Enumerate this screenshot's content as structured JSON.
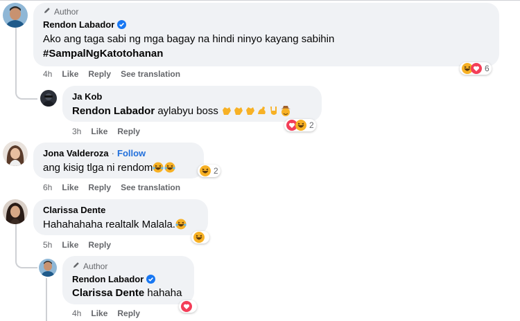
{
  "comments": [
    {
      "author_badge": "Author",
      "name": "Rendon Labador",
      "verified": true,
      "text_line1": "Ako ang taga sabi ng mga bagay na hindi ninyo kayang sabihin",
      "text_line2": "#SampalNgKatotohanan",
      "time": "4h",
      "like_label": "Like",
      "reply_label": "Reply",
      "translate_label": "See translation",
      "reactions": [
        "haha",
        "love"
      ],
      "reaction_count": "6"
    },
    {
      "name": "Ja Kob",
      "mention": "Rendon Labador",
      "text": "aylabyu boss",
      "emojis": [
        "clap",
        "clap",
        "clap",
        "muscle",
        "rock",
        "cowboy"
      ],
      "time": "3h",
      "like_label": "Like",
      "reply_label": "Reply",
      "reactions": [
        "love",
        "haha"
      ],
      "reaction_count": "2"
    },
    {
      "name": "Jona Valderoza",
      "follow_label": "Follow",
      "separator": "·",
      "text": "ang kisig tlga ni rendom",
      "emojis": [
        "laugh-tears",
        "laugh-tears"
      ],
      "time": "6h",
      "like_label": "Like",
      "reply_label": "Reply",
      "translate_label": "See translation",
      "reactions": [
        "haha"
      ],
      "reaction_count": "2"
    },
    {
      "name": "Clarissa Dente",
      "text": "Hahahahaha realtalk Malala.",
      "emojis": [
        "laugh-tears"
      ],
      "time": "5h",
      "like_label": "Like",
      "reply_label": "Reply",
      "reactions": [
        "haha"
      ],
      "reaction_count": ""
    },
    {
      "author_badge": "Author",
      "name": "Rendon Labador",
      "verified": true,
      "mention": "Clarissa Dente",
      "text": "hahaha",
      "time": "4h",
      "like_label": "Like",
      "reply_label": "Reply",
      "reactions": [
        "love"
      ],
      "reaction_count": ""
    }
  ],
  "colors": {
    "bubble": "#f0f2f5",
    "meta": "#65676b",
    "link": "#216fdb",
    "verified": "#1877f2",
    "love": "#f33e58",
    "haha": "#f7b125"
  }
}
